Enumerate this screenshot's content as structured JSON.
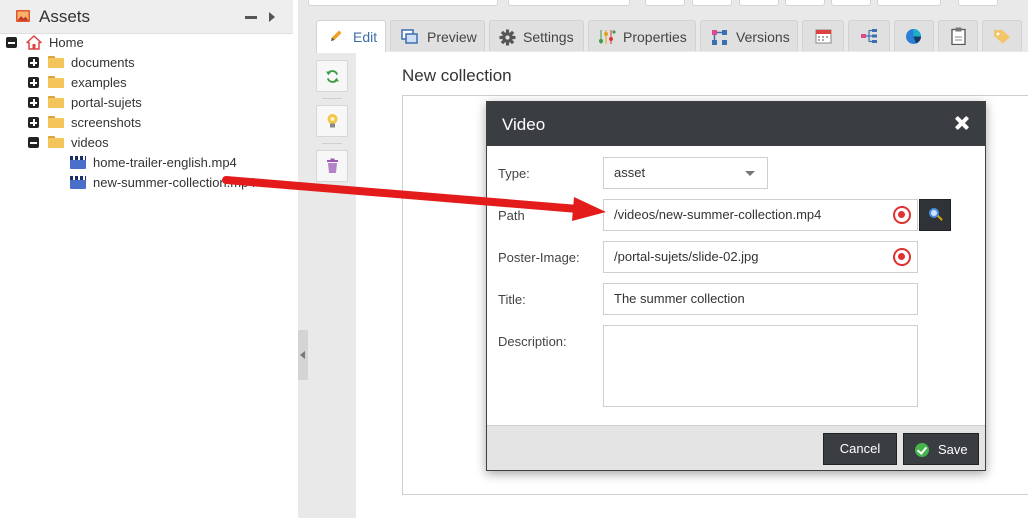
{
  "assets_panel": {
    "title": "Assets",
    "tree": {
      "root": "Home",
      "folders": [
        "documents",
        "examples",
        "portal-sujets",
        "screenshots",
        "videos"
      ],
      "video_files": [
        "home-trailer-english.mp4",
        "new-summer-collection.mp4"
      ]
    }
  },
  "editor": {
    "tabs": [
      {
        "label": "Edit",
        "icon": "pencil-icon"
      },
      {
        "label": "Preview",
        "icon": "preview-icon"
      },
      {
        "label": "Settings",
        "icon": "gear-icon"
      },
      {
        "label": "Properties",
        "icon": "properties-icon"
      },
      {
        "label": "Versions",
        "icon": "versions-icon"
      }
    ],
    "icon_tabs": [
      "calendar-icon",
      "dependencies-icon",
      "reports-icon",
      "notes-icon",
      "tags-icon"
    ],
    "side_actions": [
      "refresh-icon",
      "lightbulb-icon",
      "trash-icon"
    ],
    "page_title": "New collection"
  },
  "video_dialog": {
    "title": "Video",
    "type_label": "Type:",
    "type_value": "asset",
    "path_label": "Path",
    "path_value": "/videos/new-summer-collection.mp4",
    "poster_label": "Poster-Image:",
    "poster_value": "/portal-sujets/slide-02.jpg",
    "title_label": "Title:",
    "title_value": "The summer collection",
    "description_label": "Description:",
    "description_value": "",
    "cancel_label": "Cancel",
    "save_label": "Save"
  },
  "colors": {
    "dialog_header": "#3a3d42",
    "annotation_arrow": "#e31b1b",
    "target_icon": "#e03030",
    "save_check": "#46b34b"
  }
}
